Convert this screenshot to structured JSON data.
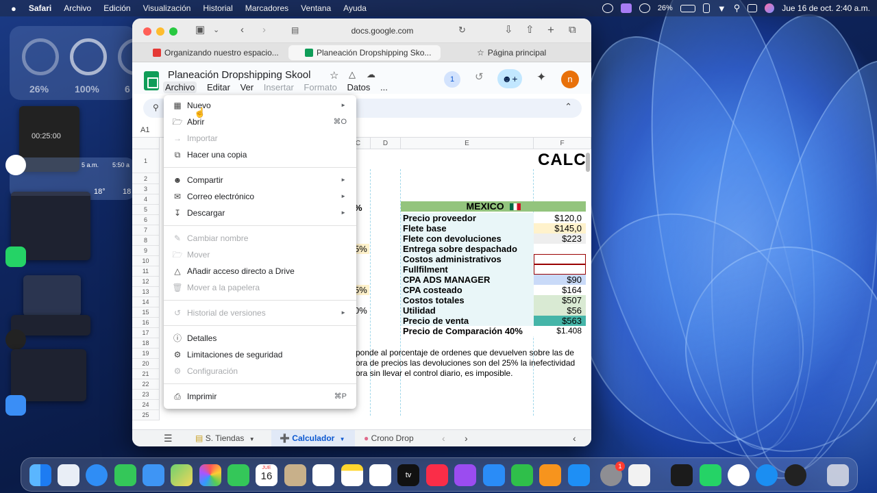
{
  "menubar": {
    "apple": "",
    "items": [
      "Safari",
      "Archivo",
      "Edición",
      "Visualización",
      "Historial",
      "Marcadores",
      "Ventana",
      "Ayuda"
    ],
    "battery": "26%",
    "datetime": "Jue 16 de oct.  2:40 a.m."
  },
  "widgets": {
    "battery_pct1": "26%",
    "battery_pct2": "100%",
    "battery_pct3": "6",
    "timer": "00:25:00",
    "weather": [
      "5 a.m.",
      "5:50 a",
      "18°",
      "18"
    ]
  },
  "browser": {
    "url": "docs.google.com",
    "tabs": [
      {
        "label": "Organizando nuestro espacio..."
      },
      {
        "label": "Planeación Dropshipping Sko..."
      },
      {
        "label": "Página principal"
      }
    ]
  },
  "sheet": {
    "title": "Planeación Dropshipping Skool",
    "menus": [
      "Archivo",
      "Editar",
      "Ver",
      "Insertar",
      "Formato",
      "Datos",
      "..."
    ],
    "collab_count": "1",
    "avatar_letter": "n",
    "cell_ref": "A1",
    "columns": [
      "C",
      "D",
      "E",
      "F"
    ],
    "rows": [
      "1",
      "2",
      "3",
      "4",
      "5",
      "6",
      "7",
      "8",
      "9",
      "10",
      "11",
      "12",
      "13",
      "14",
      "15",
      "16",
      "17",
      "18",
      "19",
      "20",
      "21",
      "22",
      "23",
      "24",
      "25"
    ],
    "big_title": "CALC",
    "country": "MEXICO",
    "labels": [
      "Precio proveedor",
      "Flete base",
      "Flete con devoluciones",
      "Entrega sobre despachado",
      "Costos administrativos",
      "Fullfilment",
      "CPA ADS MANAGER",
      "CPA costeado",
      "Costos totales",
      "Utilidad",
      "Precio de venta",
      "Precio de Comparación 40%"
    ],
    "values": [
      "$120,0",
      "$145,0",
      "$223",
      "",
      "",
      "",
      "$90",
      "$164",
      "$507",
      "$56",
      "$563",
      "$1.408"
    ],
    "partial_c": [
      "%",
      "5%",
      "5%",
      "0%"
    ],
    "note_lines": [
      "ponde al porcentaje de ordenes que devuelven sobre las de",
      "ora de precios las devoluciones son del 25% la inefectividad",
      "ora sin llevar el control diario, es imposible."
    ],
    "sheet_tabs": [
      "S. Tiendas",
      "Calculador",
      "Crono Drop"
    ]
  },
  "file_menu": {
    "items": [
      {
        "label": "Nuevo",
        "shortcut": "",
        "arrow": "►"
      },
      {
        "label": "Abrir",
        "shortcut": "⌘O",
        "arrow": ""
      },
      {
        "label": "Importar",
        "shortcut": "",
        "arrow": ""
      },
      {
        "label": "Hacer una copia",
        "shortcut": "",
        "arrow": ""
      },
      {
        "label": "Compartir",
        "shortcut": "",
        "arrow": "►"
      },
      {
        "label": "Correo electrónico",
        "shortcut": "",
        "arrow": "►"
      },
      {
        "label": "Descargar",
        "shortcut": "",
        "arrow": "►"
      },
      {
        "label": "Cambiar nombre",
        "shortcut": "",
        "arrow": ""
      },
      {
        "label": "Mover",
        "shortcut": "",
        "arrow": ""
      },
      {
        "label": "Añadir acceso directo a Drive",
        "shortcut": "",
        "arrow": ""
      },
      {
        "label": "Mover a la papelera",
        "shortcut": "",
        "arrow": ""
      },
      {
        "label": "Historial de versiones",
        "shortcut": "",
        "arrow": "►"
      },
      {
        "label": "Detalles",
        "shortcut": "",
        "arrow": ""
      },
      {
        "label": "Limitaciones de seguridad",
        "shortcut": "",
        "arrow": ""
      },
      {
        "label": "Configuración",
        "shortcut": "",
        "arrow": ""
      },
      {
        "label": "Imprimir",
        "shortcut": "⌘P",
        "arrow": ""
      }
    ]
  },
  "dock": {
    "calendar_day": "16",
    "calendar_month": "JUE",
    "tv_label": "tv",
    "settings_badge": "1"
  },
  "colors": {
    "mexico_header": "#93c47d",
    "precio_venta": "#45b5a8",
    "accent_blue": "#0b57d0",
    "sheets_green": "#0f9d58"
  }
}
